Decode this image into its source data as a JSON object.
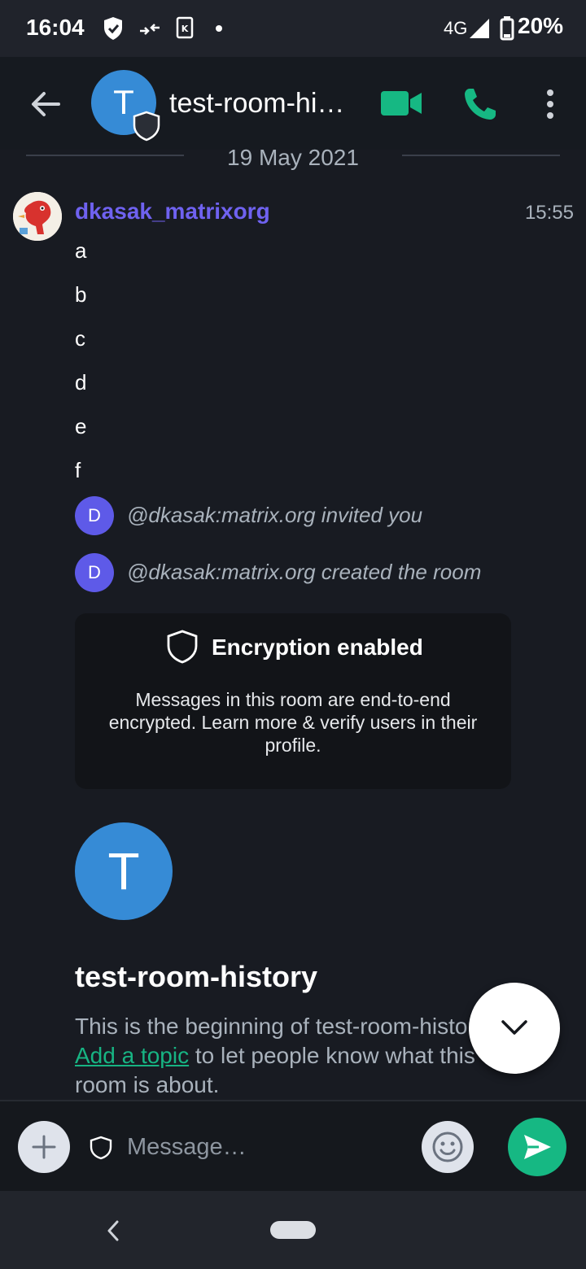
{
  "status_bar": {
    "time": "16:04",
    "network": "4G",
    "battery": "20%",
    "icons": [
      "shield-icon",
      "data-saver-icon",
      "app-notification-icon",
      "dot-icon",
      "signal-icon",
      "battery-icon"
    ]
  },
  "header": {
    "room_initial": "T",
    "room_name": "test-room-history"
  },
  "timeline": {
    "date": "19 May 2021",
    "sender": "dkasak_matrixorg",
    "time": "15:55",
    "lines": [
      "a",
      "b",
      "c",
      "d",
      "e",
      "f"
    ],
    "events": [
      {
        "initial": "D",
        "text": "@dkasak:matrix.org invited you"
      },
      {
        "initial": "D",
        "text": "@dkasak:matrix.org created the room"
      }
    ],
    "encryption": {
      "title": "Encryption enabled",
      "body": "Messages in this room are end-to-end encrypted. Learn more & verify users in their profile."
    },
    "intro": {
      "initial": "T",
      "title": "test-room-history",
      "text_before": "This is the beginning of test-room-history.",
      "link": "Add a topic",
      "text_after": " to let people know what this room is about."
    }
  },
  "composer": {
    "placeholder": "Message…"
  },
  "colors": {
    "accent_green": "#16b883",
    "avatar_blue": "#368bd6",
    "sender_purple": "#6f62f0",
    "background": "#181b22"
  }
}
